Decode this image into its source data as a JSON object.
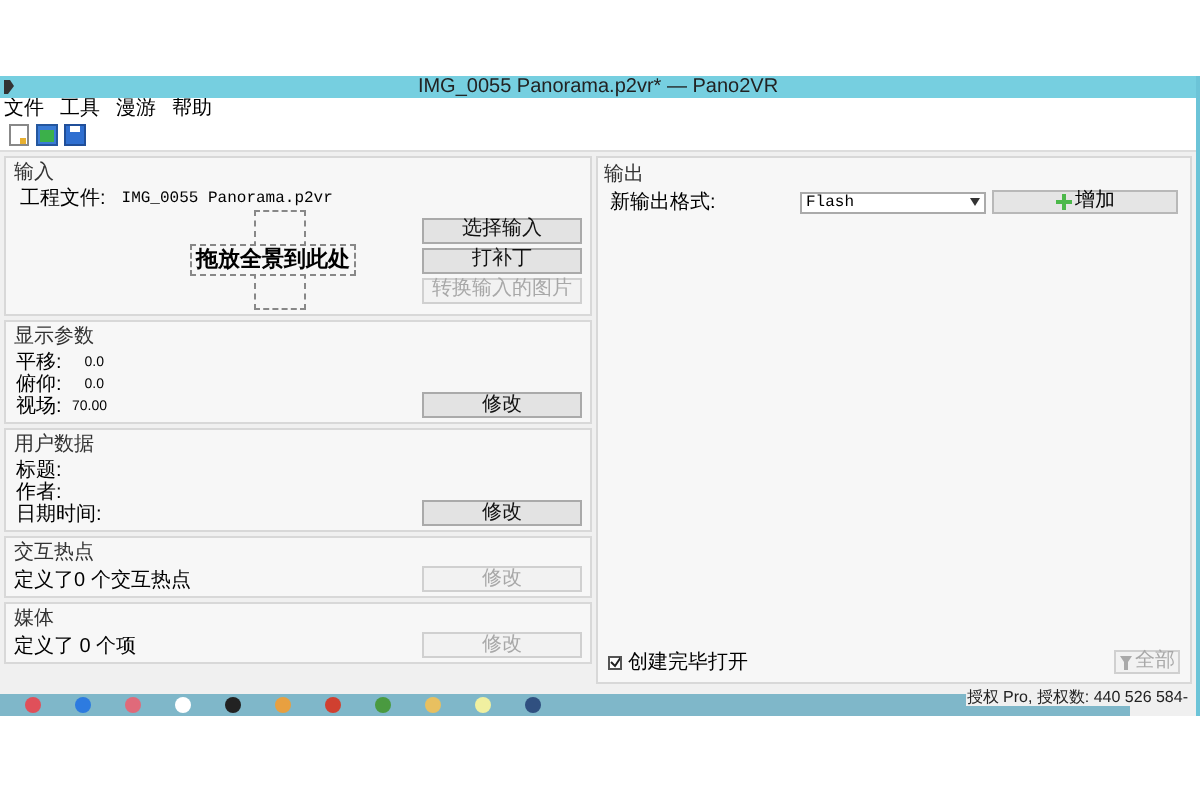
{
  "window": {
    "title": "IMG_0055 Panorama.p2vr* — Pano2VR"
  },
  "menu": [
    "文件",
    "工具",
    "漫游",
    "帮助"
  ],
  "input": {
    "title": "输入",
    "project_label": "工程文件:",
    "project_value": "IMG_0055 Panorama.p2vr",
    "drop_text": "拖放全景到此处",
    "buttons": [
      {
        "label": "选择输入",
        "disabled": false
      },
      {
        "label": "打补丁",
        "disabled": false
      },
      {
        "label": "转换输入的图片",
        "disabled": true
      }
    ]
  },
  "display": {
    "title": "显示参数",
    "rows": [
      {
        "label": "平移:",
        "value": "0.0"
      },
      {
        "label": "俯仰:",
        "value": "0.0"
      },
      {
        "label": "视场:",
        "value": "70.00"
      }
    ],
    "button": {
      "label": "修改",
      "disabled": false
    }
  },
  "user_data": {
    "title": "用户数据",
    "rows": [
      "标题:",
      "作者:",
      "日期时间:"
    ],
    "button": {
      "label": "修改",
      "disabled": false
    }
  },
  "hotspots": {
    "title": "交互热点",
    "text": "定义了0 个交互热点",
    "button": {
      "label": "修改",
      "disabled": true
    }
  },
  "media": {
    "title": "媒体",
    "text": "定义了 0 个项",
    "button": {
      "label": "修改",
      "disabled": true
    }
  },
  "output": {
    "title": "输出",
    "format_label": "新输出格式:",
    "format_value": "Flash",
    "add_button": "增加",
    "open_after": {
      "label": "创建完毕打开",
      "checked": true
    },
    "all_button": {
      "label": "全部",
      "disabled": true
    }
  },
  "status_bar": "授权 Pro, 授权数: 440 526 584-"
}
